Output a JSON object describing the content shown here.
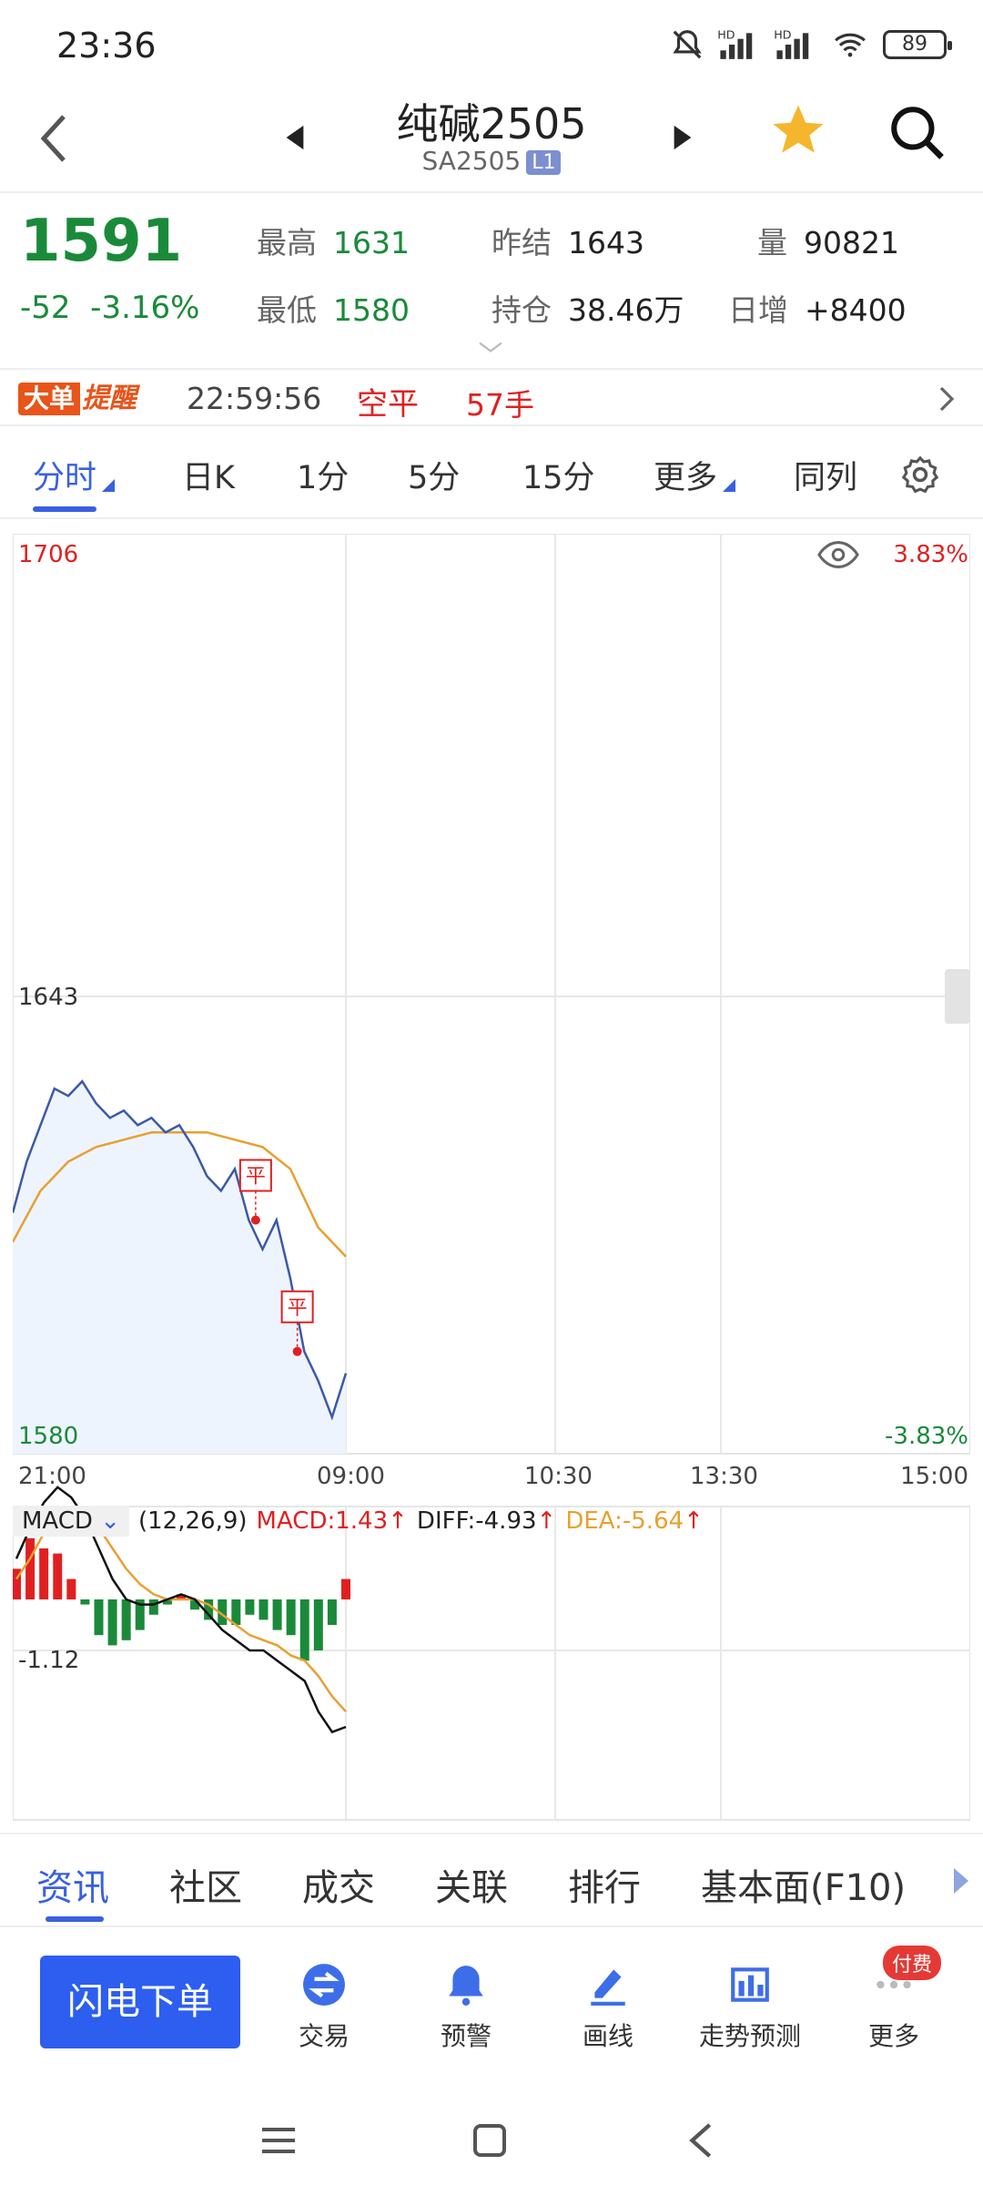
{
  "status_bar": {
    "time": "23:36",
    "battery": "89",
    "signal_labels": [
      "HD",
      "HD"
    ]
  },
  "header": {
    "title": "纯碱2505",
    "subtitle": "SA2505",
    "badge": "L1"
  },
  "quote": {
    "price": "1591",
    "change": "-52",
    "change_pct": "-3.16%",
    "high_label": "最高",
    "high": "1631",
    "low_label": "最低",
    "low": "1580",
    "prev_settle_label": "昨结",
    "prev_settle": "1643",
    "open_interest_label": "持仓",
    "open_interest": "38.46万",
    "volume_label": "量",
    "volume": "90821",
    "daily_increase_label": "日增",
    "daily_increase": "+8400"
  },
  "alert": {
    "tag_left": "大单",
    "tag_right": "提醒",
    "time": "22:59:56",
    "type": "空平",
    "quantity": "57手"
  },
  "period_tabs": [
    {
      "label": "分时",
      "active": true
    },
    {
      "label": "日K"
    },
    {
      "label": "1分"
    },
    {
      "label": "5分"
    },
    {
      "label": "15分"
    },
    {
      "label": "更多"
    },
    {
      "label": "同列"
    }
  ],
  "chart": {
    "y_max_label": "1706",
    "y_mid_label": "1643",
    "y_min_label": "1580",
    "pct_max_label": "3.83%",
    "pct_min_label": "-3.83%",
    "time_labels": [
      "21:00",
      "09:00",
      "10:30",
      "13:30",
      "15:00"
    ],
    "marker_label": "平"
  },
  "macd": {
    "name": "MACD",
    "params": "(12,26,9)",
    "macd_value": "MACD:1.43",
    "diff_value": "DIFF:-4.93",
    "dea_value": "DEA:-5.64",
    "axis_label": "-1.12"
  },
  "bottom_tabs": [
    {
      "label": "资讯",
      "active": true
    },
    {
      "label": "社区"
    },
    {
      "label": "成交"
    },
    {
      "label": "关联"
    },
    {
      "label": "排行"
    },
    {
      "label": "基本面(F10)"
    }
  ],
  "toolbar": {
    "flash_order": "闪电下单",
    "items": [
      {
        "label": "交易",
        "icon": "trade-icon"
      },
      {
        "label": "预警",
        "icon": "bell-icon"
      },
      {
        "label": "画线",
        "icon": "draw-line-icon"
      },
      {
        "label": "走势预测",
        "icon": "trend-forecast-icon"
      },
      {
        "label": "更多",
        "icon": "more-icon"
      }
    ],
    "paid_badge": "付费"
  },
  "colors": {
    "down_green": "#1a8a3a",
    "up_red": "#e02020",
    "accent_blue": "#3860e0",
    "price_line": "#3b5aa8",
    "avg_line": "#e8a030"
  },
  "chart_data": {
    "type": "line",
    "x_axis": [
      "21:00",
      "09:00",
      "10:30",
      "13:30",
      "15:00"
    ],
    "ylim": [
      1580,
      1706
    ],
    "series": [
      {
        "name": "price",
        "x": [
          0,
          10,
          20,
          30,
          40,
          50,
          60,
          70,
          80,
          90,
          100,
          110,
          120,
          130,
          140,
          150,
          160,
          170,
          180,
          190,
          200,
          210,
          220,
          230,
          240
        ],
        "values": [
          1613,
          1620,
          1625,
          1630,
          1629,
          1631,
          1628,
          1626,
          1627,
          1625,
          1626,
          1624,
          1625,
          1622,
          1618,
          1616,
          1619,
          1612,
          1608,
          1612,
          1604,
          1594,
          1590,
          1585,
          1591
        ]
      },
      {
        "name": "avg",
        "x": [
          0,
          20,
          40,
          60,
          80,
          100,
          120,
          140,
          160,
          180,
          200,
          220,
          240
        ],
        "values": [
          1609,
          1616,
          1620,
          1622,
          1623,
          1624,
          1624,
          1624,
          1623,
          1622,
          1619,
          1611,
          1607
        ]
      }
    ],
    "markers": [
      {
        "x": 175,
        "value": 1612,
        "label": "平"
      },
      {
        "x": 205,
        "value": 1594,
        "label": "平"
      }
    ],
    "macd": {
      "diff": [
        8,
        14,
        19,
        22,
        20,
        16,
        10,
        4,
        0,
        -1,
        -1,
        0,
        1,
        0,
        -3,
        -6,
        -8,
        -10,
        -10,
        -12,
        -14,
        -16,
        -22,
        -26,
        -25
      ],
      "dea": [
        4,
        8,
        13,
        17,
        18,
        17,
        14,
        10,
        6,
        3,
        1,
        0,
        0,
        0,
        -1,
        -3,
        -5,
        -7,
        -8,
        -9,
        -11,
        -12,
        -15,
        -19,
        -22
      ],
      "hist": [
        6,
        12,
        10,
        9,
        4,
        -1,
        -7,
        -9,
        -8,
        -6,
        -3,
        -1,
        1,
        -2,
        -4,
        -5,
        -5,
        -3,
        -4,
        -6,
        -7,
        -12,
        -10,
        -5,
        4
      ]
    }
  }
}
